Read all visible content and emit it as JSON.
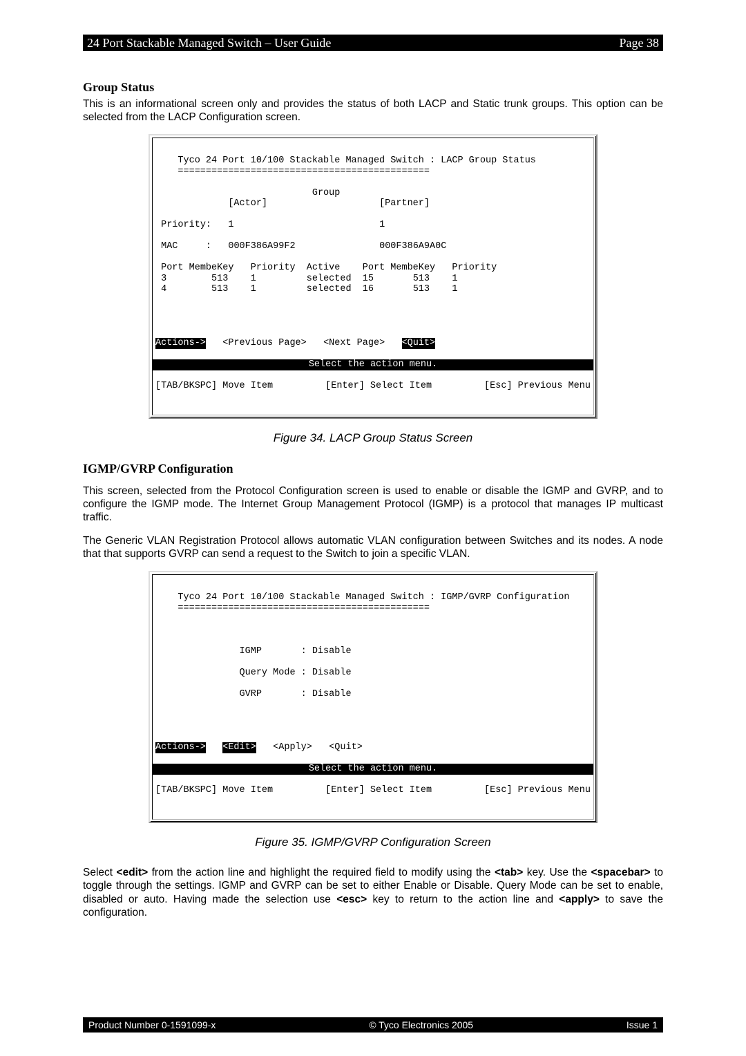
{
  "header": {
    "left": "24 Port Stackable Managed Switch – User Guide",
    "right": "Page 38"
  },
  "sec1": {
    "title": "Group Status",
    "p1": "This is an informational screen only and provides the status of both LACP and Static trunk groups. This option can be selected from the LACP Configuration screen."
  },
  "term1": {
    "title_line": "Tyco 24 Port 10/100 Stackable Managed Switch : LACP Group Status",
    "rule": "=============================================",
    "group_lbl": "Group",
    "actor_lbl": "[Actor]",
    "partner_lbl": "[Partner]",
    "priority_lbl": "Priority:",
    "actor_priority": "1",
    "partner_priority": "1",
    "mac_lbl": "MAC     :",
    "actor_mac": "000F386A99F2",
    "partner_mac": "000F386A9A0C",
    "col_a": "Port MembeKey   Priority",
    "col_b": "Active",
    "col_c": "Port MembeKey   Priority",
    "rows": [
      {
        "a": "3        513    1",
        "b": "selected",
        "c": "15       513    1"
      },
      {
        "a": "4        513    1",
        "b": "selected",
        "c": "16       513    1"
      }
    ],
    "actions_lbl": "Actions->",
    "act_prev": "<Previous Page>",
    "act_next": "<Next Page>",
    "act_quit": "<Quit>",
    "blackbar": "Select the action menu.",
    "foot_left": "[TAB/BKSPC] Move Item",
    "foot_mid": "[Enter] Select Item",
    "foot_right": "[Esc] Previous Menu"
  },
  "caption1": "Figure 34. LACP Group Status Screen",
  "sec2": {
    "title": "IGMP/GVRP Configuration",
    "p1": "This screen, selected from the Protocol Configuration screen is used to enable or disable the IGMP and GVRP, and to configure the IGMP mode. The Internet Group Management Protocol (IGMP) is a protocol that manages IP multicast traffic.",
    "p2": "The Generic VLAN Registration Protocol allows automatic VLAN configuration between Switches and its nodes. A node that that supports GVRP can send a request to the Switch to join a specific VLAN."
  },
  "term2": {
    "title_line": "Tyco 24 Port 10/100 Stackable Managed Switch : IGMP/GVRP Configuration",
    "rule": "=============================================",
    "igmp_lbl": "IGMP",
    "igmp_val": "Disable",
    "qm_lbl": "Query Mode",
    "qm_val": "Disable",
    "gvrp_lbl": "GVRP",
    "gvrp_val": "Disable",
    "actions_lbl": "Actions->",
    "act_edit": "<Edit>",
    "act_apply": "<Apply>",
    "act_quit": "<Quit>",
    "blackbar": "Select the action menu.",
    "foot_left": "[TAB/BKSPC] Move Item",
    "foot_mid": "[Enter] Select Item",
    "foot_right": "[Esc] Previous Menu"
  },
  "caption2": "Figure 35. IGMP/GVRP Configuration Screen",
  "closing": {
    "pre1": "Select ",
    "k1": "<edit>",
    "mid1": " from the action line and highlight the required field to modify using the ",
    "k2": "<tab>",
    "mid2": " key. Use the ",
    "k3": "<spacebar>",
    "mid3": " to toggle through the settings. IGMP and GVRP can be set to either Enable or Disable. Query Mode can be set to enable, disabled or auto. Having made the selection use ",
    "k4": "<esc>",
    "mid4": " key to return to the action line and ",
    "k5": "<apply>",
    "mid5": " to save the configuration."
  },
  "footer": {
    "left": "Product Number 0-1591099-x",
    "mid": "© Tyco Electronics 2005",
    "right": "Issue 1"
  }
}
